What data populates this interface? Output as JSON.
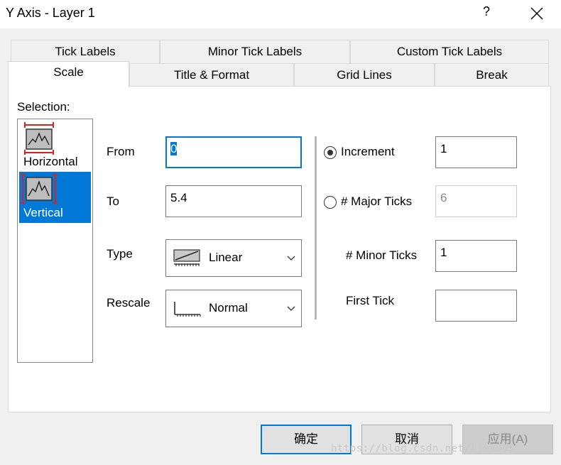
{
  "window": {
    "title": "Y Axis - Layer 1",
    "help": "?",
    "close_icon": "close-icon"
  },
  "tabs": {
    "row1": [
      "Tick Labels",
      "Minor Tick Labels",
      "Custom Tick Labels"
    ],
    "row2": [
      "Scale",
      "Title & Format",
      "Grid Lines",
      "Break"
    ],
    "active": "Scale"
  },
  "selection": {
    "label": "Selection:",
    "items": [
      {
        "label": "Horizontal",
        "icon": "horizontal-axis-icon",
        "selected": false
      },
      {
        "label": "Vertical",
        "icon": "vertical-axis-icon",
        "selected": true
      }
    ]
  },
  "scale": {
    "from_label": "From",
    "from_value": "0",
    "to_label": "To",
    "to_value": "5.4",
    "type_label": "Type",
    "type_value": "Linear",
    "type_icon": "linear-scale-icon",
    "rescale_label": "Rescale",
    "rescale_value": "Normal",
    "rescale_icon": "normal-rescale-icon"
  },
  "ticks": {
    "increment_label": "Increment",
    "increment_value": "1",
    "increment_selected": true,
    "major_label": "# Major Ticks",
    "major_value": "6",
    "major_selected": false,
    "minor_label": "# Minor Ticks",
    "minor_value": "1",
    "first_label": "First Tick",
    "first_value": ""
  },
  "buttons": {
    "ok": "确定",
    "cancel": "取消",
    "apply": "应用(A)"
  },
  "watermark": "https://blog.csdn.net/ljm1995",
  "colors": {
    "accent": "#0078d7",
    "axis_marker": "#e0201b"
  }
}
